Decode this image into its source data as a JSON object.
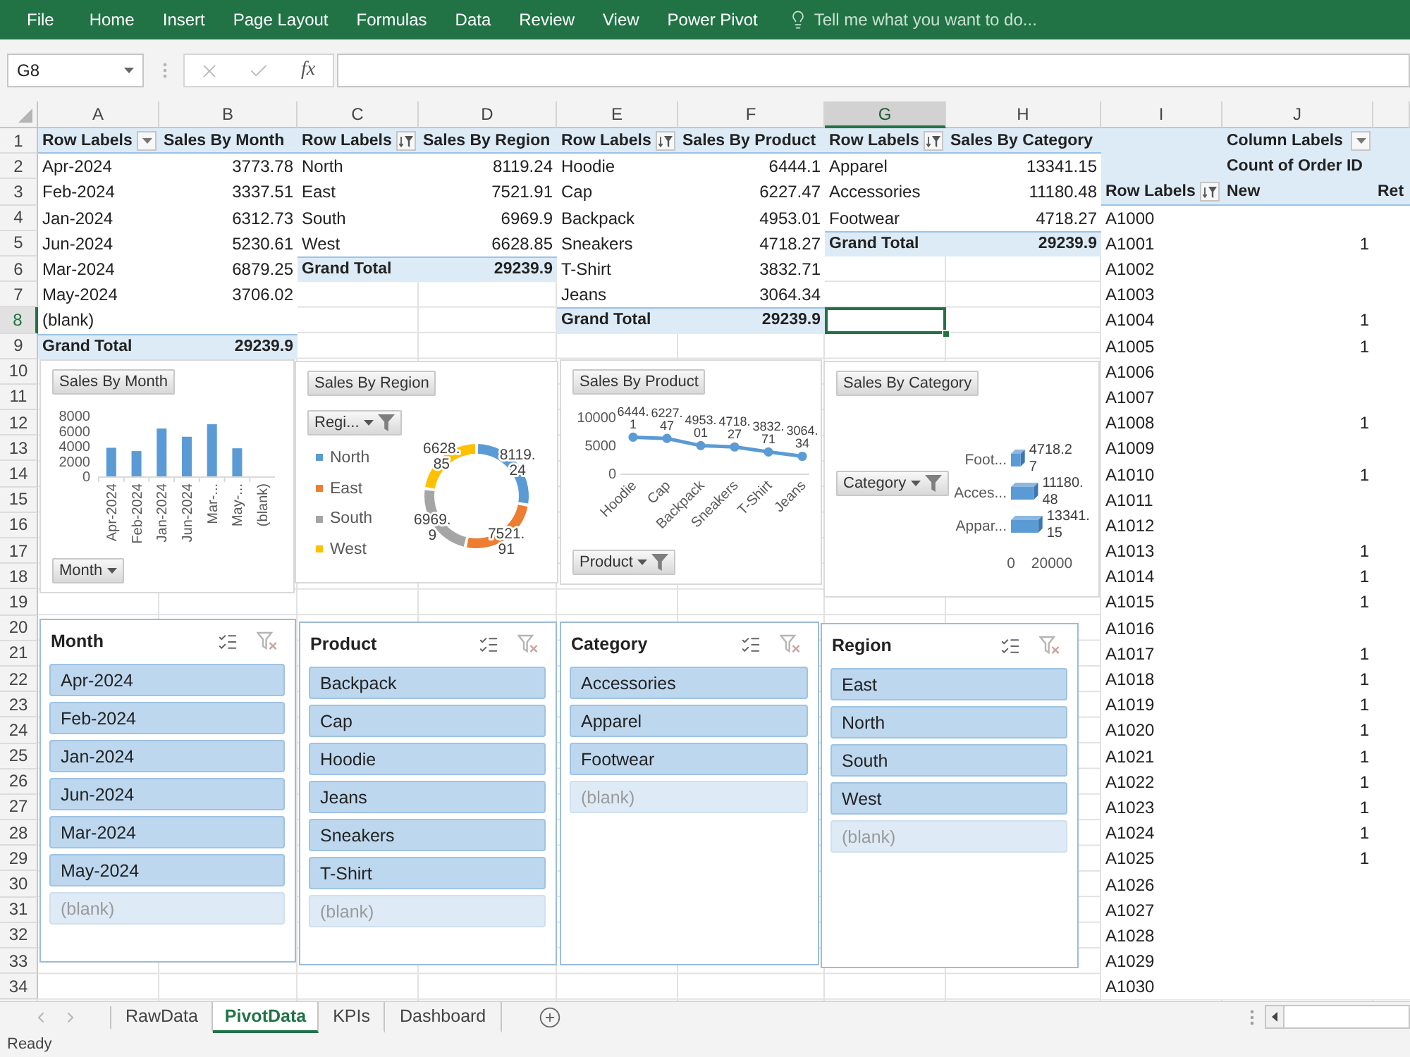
{
  "ribbon": {
    "tabs": [
      {
        "label": "File",
        "selected": false
      },
      {
        "label": "Home",
        "selected": false
      },
      {
        "label": "Insert",
        "selected": false
      },
      {
        "label": "Page Layout",
        "selected": false
      },
      {
        "label": "Formulas",
        "selected": false
      },
      {
        "label": "Data",
        "selected": false
      },
      {
        "label": "Review",
        "selected": false
      },
      {
        "label": "View",
        "selected": false
      },
      {
        "label": "Power Pivot",
        "selected": false
      }
    ],
    "tell_me": {
      "placeholder": "Tell me what you want to do..."
    }
  },
  "formula_bar": {
    "name_box": "G8",
    "function_label": "fx"
  },
  "sheet": {
    "columns": [
      {
        "label": "A",
        "selected": false
      },
      {
        "label": "B",
        "selected": false
      },
      {
        "label": "C",
        "selected": false
      },
      {
        "label": "D",
        "selected": false
      },
      {
        "label": "E",
        "selected": false
      },
      {
        "label": "F",
        "selected": false
      },
      {
        "label": "G",
        "selected": true
      },
      {
        "label": "H",
        "selected": false
      },
      {
        "label": "I",
        "selected": false
      },
      {
        "label": "J",
        "selected": false
      }
    ],
    "rows": [
      {
        "label": "1",
        "selected": false
      },
      {
        "label": "2",
        "selected": false
      },
      {
        "label": "3",
        "selected": false
      },
      {
        "label": "4",
        "selected": false
      },
      {
        "label": "5",
        "selected": false
      },
      {
        "label": "6",
        "selected": false
      },
      {
        "label": "7",
        "selected": false
      },
      {
        "label": "8",
        "selected": true
      },
      {
        "label": "9",
        "selected": false
      },
      {
        "label": "10",
        "selected": false
      },
      {
        "label": "11",
        "selected": false
      },
      {
        "label": "12",
        "selected": false
      },
      {
        "label": "13",
        "selected": false
      },
      {
        "label": "14",
        "selected": false
      },
      {
        "label": "15",
        "selected": false
      },
      {
        "label": "16",
        "selected": false
      },
      {
        "label": "17",
        "selected": false
      },
      {
        "label": "18",
        "selected": false
      },
      {
        "label": "19",
        "selected": false
      },
      {
        "label": "20",
        "selected": false
      },
      {
        "label": "21",
        "selected": false
      },
      {
        "label": "22",
        "selected": false
      },
      {
        "label": "23",
        "selected": false
      },
      {
        "label": "24",
        "selected": false
      },
      {
        "label": "25",
        "selected": false
      },
      {
        "label": "26",
        "selected": false
      },
      {
        "label": "27",
        "selected": false
      },
      {
        "label": "28",
        "selected": false
      },
      {
        "label": "29",
        "selected": false
      },
      {
        "label": "30",
        "selected": false
      },
      {
        "label": "31",
        "selected": false
      },
      {
        "label": "32",
        "selected": false
      },
      {
        "label": "33",
        "selected": false
      },
      {
        "label": "34",
        "selected": false
      }
    ]
  },
  "pivot_tables": [
    {
      "kind": "simple",
      "row_labels": "Row Labels",
      "row_labels_filtered": false,
      "value_field": "Sales By Month",
      "rows": [
        {
          "label": "Apr-2024",
          "value": "3773.78"
        },
        {
          "label": "Feb-2024",
          "value": "3337.51"
        },
        {
          "label": "Jan-2024",
          "value": "6312.73"
        },
        {
          "label": "Jun-2024",
          "value": "5230.61"
        },
        {
          "label": "Mar-2024",
          "value": "6879.25"
        },
        {
          "label": "May-2024",
          "value": "3706.02"
        },
        {
          "label": "(blank)"
        }
      ],
      "total": {
        "label": "Grand Total",
        "value": "29239.9"
      }
    },
    {
      "kind": "simple",
      "row_labels": "Row Labels",
      "row_labels_filtered": true,
      "value_field": "Sales By Region",
      "rows": [
        {
          "label": "North",
          "value": "8119.24"
        },
        {
          "label": "East",
          "value": "7521.91"
        },
        {
          "label": "South",
          "value": "6969.9"
        },
        {
          "label": "West",
          "value": "6628.85"
        }
      ],
      "total": {
        "label": "Grand Total",
        "value": "29239.9"
      }
    },
    {
      "kind": "simple",
      "row_labels": "Row Labels",
      "row_labels_filtered": true,
      "value_field": "Sales By Product",
      "rows": [
        {
          "label": "Hoodie",
          "value": "6444.1"
        },
        {
          "label": "Cap",
          "value": "6227.47"
        },
        {
          "label": "Backpack",
          "value": "4953.01"
        },
        {
          "label": "Sneakers",
          "value": "4718.27"
        },
        {
          "label": "T-Shirt",
          "value": "3832.71"
        },
        {
          "label": "Jeans",
          "value": "3064.34"
        }
      ],
      "total": {
        "label": "Grand Total",
        "value": "29239.9"
      }
    },
    {
      "kind": "simple",
      "row_labels": "Row Labels",
      "row_labels_filtered": true,
      "value_field": "Sales By Category",
      "rows": [
        {
          "label": "Apparel",
          "value": "13341.15"
        },
        {
          "label": "Accessories",
          "value": "11180.48"
        },
        {
          "label": "Footwear",
          "value": "4718.27"
        }
      ],
      "total": {
        "label": "Grand Total",
        "value": "29239.9"
      }
    },
    {
      "kind": "crosstab",
      "column_labels": "Column Labels",
      "column_labels_filtered": false,
      "value_field": "Count of Order ID",
      "row_labels": "Row Labels",
      "row_labels_filtered": true,
      "columns": [
        "New",
        "Ret"
      ],
      "rows": [
        {
          "label": "A1000"
        },
        {
          "label": "A1001",
          "values": [
            "1"
          ]
        },
        {
          "label": "A1002"
        },
        {
          "label": "A1003"
        },
        {
          "label": "A1004",
          "values": [
            "1"
          ]
        },
        {
          "label": "A1005",
          "values": [
            "1"
          ]
        },
        {
          "label": "A1006"
        },
        {
          "label": "A1007"
        },
        {
          "label": "A1008",
          "values": [
            "1"
          ]
        },
        {
          "label": "A1009"
        },
        {
          "label": "A1010",
          "values": [
            "1"
          ]
        },
        {
          "label": "A1011"
        },
        {
          "label": "A1012"
        },
        {
          "label": "A1013",
          "values": [
            "1"
          ]
        },
        {
          "label": "A1014",
          "values": [
            "1"
          ]
        },
        {
          "label": "A1015",
          "values": [
            "1"
          ]
        },
        {
          "label": "A1016"
        },
        {
          "label": "A1017",
          "values": [
            "1"
          ]
        },
        {
          "label": "A1018",
          "values": [
            "1"
          ]
        },
        {
          "label": "A1019",
          "values": [
            "1"
          ]
        },
        {
          "label": "A1020",
          "values": [
            "1"
          ]
        },
        {
          "label": "A1021",
          "values": [
            "1"
          ]
        },
        {
          "label": "A1022",
          "values": [
            "1"
          ]
        },
        {
          "label": "A1023",
          "values": [
            "1"
          ]
        },
        {
          "label": "A1024",
          "values": [
            "1"
          ]
        },
        {
          "label": "A1025",
          "values": [
            "1"
          ]
        },
        {
          "label": "A1026"
        },
        {
          "label": "A1027"
        },
        {
          "label": "A1028"
        },
        {
          "label": "A1029"
        },
        {
          "label": "A1030"
        }
      ]
    }
  ],
  "charts": [
    {
      "field_button": {
        "label": "Month",
        "filtered": false
      },
      "chart_data": {
        "type": "bar",
        "orientation": "vertical",
        "title": "Sales By Month",
        "categories": [
          "Apr-2024",
          "Feb-2024",
          "Jan-2024",
          "Jun-2024",
          "Mar-...",
          "May-...",
          "(blank)"
        ],
        "values": [
          3773.78,
          3337.51,
          6312.73,
          5230.61,
          6879.25,
          3706.02,
          null
        ],
        "ylim": [
          0,
          8000
        ],
        "yticks": [
          0,
          2000,
          4000,
          6000,
          8000
        ]
      }
    },
    {
      "field_button": {
        "label": "Regi...",
        "filtered": true
      },
      "chart_data": {
        "type": "donut",
        "title": "Sales By Region",
        "categories": [
          "North",
          "East",
          "South",
          "West"
        ],
        "values": [
          8119.24,
          7521.91,
          6969.9,
          6628.85
        ],
        "colors": [
          "#5b9bd5",
          "#ed7d31",
          "#a5a5a5",
          "#ffc000"
        ],
        "data_labels": true
      }
    },
    {
      "field_button": {
        "label": "Product",
        "filtered": true
      },
      "chart_data": {
        "type": "line",
        "title": "Sales By Product",
        "categories": [
          "Hoodie",
          "Cap",
          "Backpack",
          "Sneakers",
          "T-Shirt",
          "Jeans"
        ],
        "values": [
          6444.1,
          6227.47,
          4953.01,
          4718.27,
          3832.71,
          3064.34
        ],
        "marker": true,
        "ylim": [
          0,
          10000
        ],
        "yticks": [
          0,
          5000,
          10000
        ],
        "data_labels": true
      }
    },
    {
      "field_button": {
        "label": "Category",
        "filtered": true
      },
      "chart_data": {
        "type": "bar",
        "orientation": "horizontal",
        "title": "Sales By Category",
        "categories": [
          "Foot...",
          "Acces...",
          "Appar..."
        ],
        "values": [
          4718.27,
          11180.48,
          13341.15
        ],
        "xlim": [
          0,
          20000
        ],
        "xticks": [
          0,
          20000
        ],
        "data_labels": true
      }
    }
  ],
  "slicers": [
    {
      "title": "Month",
      "clear_filter_disabled": true,
      "items": [
        {
          "label": "Apr-2024",
          "selected": true
        },
        {
          "label": "Feb-2024",
          "selected": true
        },
        {
          "label": "Jan-2024",
          "selected": true
        },
        {
          "label": "Jun-2024",
          "selected": true
        },
        {
          "label": "Mar-2024",
          "selected": true
        },
        {
          "label": "May-2024",
          "selected": true
        },
        {
          "label": "(blank)",
          "selected": false
        }
      ]
    },
    {
      "title": "Product",
      "clear_filter_disabled": true,
      "items": [
        {
          "label": "Backpack",
          "selected": true
        },
        {
          "label": "Cap",
          "selected": true
        },
        {
          "label": "Hoodie",
          "selected": true
        },
        {
          "label": "Jeans",
          "selected": true
        },
        {
          "label": "Sneakers",
          "selected": true
        },
        {
          "label": "T-Shirt",
          "selected": true
        },
        {
          "label": "(blank)",
          "selected": false
        }
      ]
    },
    {
      "title": "Category",
      "clear_filter_disabled": true,
      "items": [
        {
          "label": "Accessories",
          "selected": true
        },
        {
          "label": "Apparel",
          "selected": true
        },
        {
          "label": "Footwear",
          "selected": true
        },
        {
          "label": "(blank)",
          "selected": false
        }
      ]
    },
    {
      "title": "Region",
      "clear_filter_disabled": true,
      "items": [
        {
          "label": "East",
          "selected": true
        },
        {
          "label": "North",
          "selected": true
        },
        {
          "label": "South",
          "selected": true
        },
        {
          "label": "West",
          "selected": true
        },
        {
          "label": "(blank)",
          "selected": false
        }
      ]
    }
  ],
  "sheet_tabs": [
    {
      "label": "RawData",
      "selected": false
    },
    {
      "label": "PivotData",
      "selected": true
    },
    {
      "label": "KPIs",
      "selected": false
    },
    {
      "label": "Dashboard",
      "selected": false
    }
  ],
  "status_bar": {
    "text": "Ready"
  }
}
